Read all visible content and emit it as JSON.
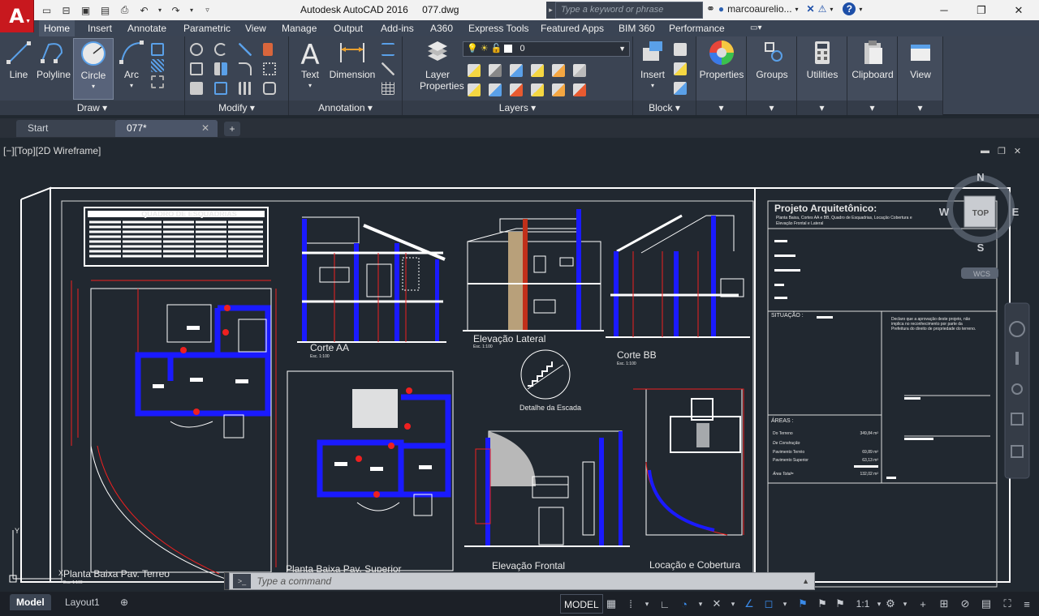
{
  "title_bar": {
    "window_title": "Autodesk AutoCAD 2016",
    "filename": "077.dwg",
    "search_placeholder": "Type a keyword or phrase",
    "user": "marcoaurelio...",
    "help_label": "?"
  },
  "ribbon_tabs": [
    "Home",
    "Insert",
    "Annotate",
    "Parametric",
    "View",
    "Manage",
    "Output",
    "Add-ins",
    "A360",
    "Express Tools",
    "Featured Apps",
    "BIM 360",
    "Performance"
  ],
  "active_tab": "Home",
  "ribbon": {
    "draw": {
      "title": "Draw",
      "tools": [
        "Line",
        "Polyline",
        "Circle",
        "Arc"
      ]
    },
    "modify": {
      "title": "Modify"
    },
    "annotation": {
      "title": "Annotation",
      "tools": [
        "Text",
        "Dimension"
      ]
    },
    "layers": {
      "title": "Layers",
      "tool": "Layer Properties",
      "current_layer": "0"
    },
    "block": {
      "title": "Block",
      "tool": "Insert"
    },
    "properties": {
      "tool": "Properties"
    },
    "groups": {
      "tool": "Groups"
    },
    "utilities": {
      "tool": "Utilities"
    },
    "clipboard": {
      "tool": "Clipboard"
    },
    "view": {
      "tool": "View"
    }
  },
  "doc_tabs": [
    {
      "label": "Start"
    },
    {
      "label": "077*",
      "active": true
    }
  ],
  "viewport_label": "[−][Top][2D Wireframe]",
  "viewcube": {
    "n": "N",
    "s": "S",
    "e": "E",
    "w": "W",
    "face": "TOP",
    "wcs": "WCS"
  },
  "drawing_labels": {
    "quadro": "QUADRO DE ESQUADRIAS",
    "corte_aa": "Corte AA",
    "elev_lateral": "Elevação Lateral",
    "corte_bb": "Corte BB",
    "detalhe": "Detalhe da Escada",
    "planta_terreo": "Planta Baixa Pav. Terreo",
    "planta_superior": "Planta Baixa Pav. Superior",
    "elev_frontal": "Elevação Frontal",
    "locacao": "Locação e Cobertura",
    "scale": "Esc. 1:100",
    "projeto_title": "Projeto Arquitetônico:",
    "projeto_sub1": "Planta Baixa, Cortes AA e BB, Quadro de Esquadrias, Locação Cobertura e",
    "projeto_sub2": "Elevação Frontal e Lateral",
    "situacao": "SITUAÇÃO :",
    "declaro1": "Declaro que a aprovação deste projeto, não",
    "declaro2": "implica no reconhecimento por parte da",
    "declaro3": "Prefeitura do direito de propriedade do terreno.",
    "areas": "ÁREAS :",
    "area_rows": [
      {
        "label": "Do Terreno",
        "value": "349,84 m²"
      },
      {
        "label": "De Construção",
        "value": ""
      },
      {
        "label": "Pavimento Terréo",
        "value": "69,89 m²"
      },
      {
        "label": "Pavimento Superior",
        "value": "63,13 m²"
      },
      {
        "label": "Área Total=",
        "value": "132,02 m²"
      }
    ]
  },
  "command_placeholder": "Type a command",
  "layout_tabs": [
    "Model",
    "Layout1"
  ],
  "status": {
    "model": "MODEL",
    "scale": "1:1"
  },
  "colors": {
    "blue": "#1a1aff",
    "red": "#e01010",
    "accent": "#c8181e"
  }
}
